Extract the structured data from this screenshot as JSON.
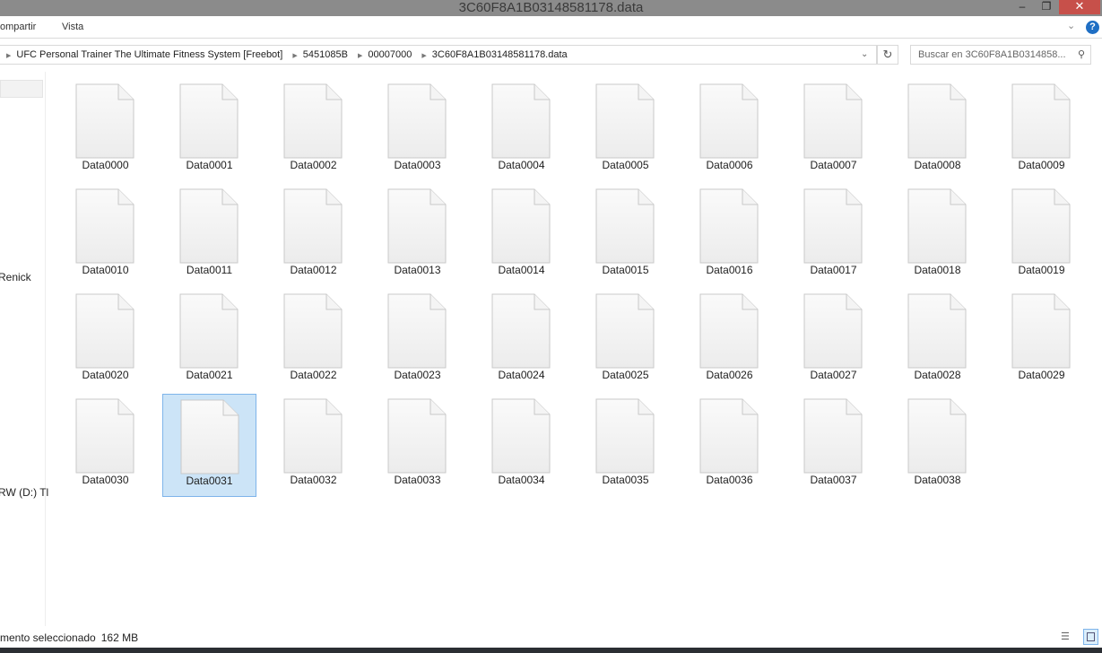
{
  "window": {
    "title": "3C60F8A1B03148581178.data",
    "minimize": "–",
    "restore": "❐",
    "close": "✕"
  },
  "ribbon": {
    "tabs": [
      "ompartir",
      "Vista"
    ],
    "expand": "⌄",
    "help": "?"
  },
  "address": {
    "crumbs": [
      "UFC Personal Trainer The Ultimate Fitness System [Freebot]",
      "5451085B",
      "00007000",
      "3C60F8A1B03148581178.data"
    ],
    "dropdown": "⌄",
    "refresh": "↻"
  },
  "search": {
    "placeholder": "Buscar en 3C60F8A1B0314858...",
    "icon": "⚲"
  },
  "sidebar": {
    "items": [
      "Renick",
      "RW (D:) Tl"
    ]
  },
  "files": {
    "selected_index": 31,
    "items": [
      "Data0000",
      "Data0001",
      "Data0002",
      "Data0003",
      "Data0004",
      "Data0005",
      "Data0006",
      "Data0007",
      "Data0008",
      "Data0009",
      "Data0010",
      "Data0011",
      "Data0012",
      "Data0013",
      "Data0014",
      "Data0015",
      "Data0016",
      "Data0017",
      "Data0018",
      "Data0019",
      "Data0020",
      "Data0021",
      "Data0022",
      "Data0023",
      "Data0024",
      "Data0025",
      "Data0026",
      "Data0027",
      "Data0028",
      "Data0029",
      "Data0030",
      "Data0031",
      "Data0032",
      "Data0033",
      "Data0034",
      "Data0035",
      "Data0036",
      "Data0037",
      "Data0038"
    ]
  },
  "status": {
    "selection": "mento seleccionado",
    "size": "162 MB"
  },
  "colors": {
    "selection": "#cce4f7",
    "close": "#c7504a"
  }
}
